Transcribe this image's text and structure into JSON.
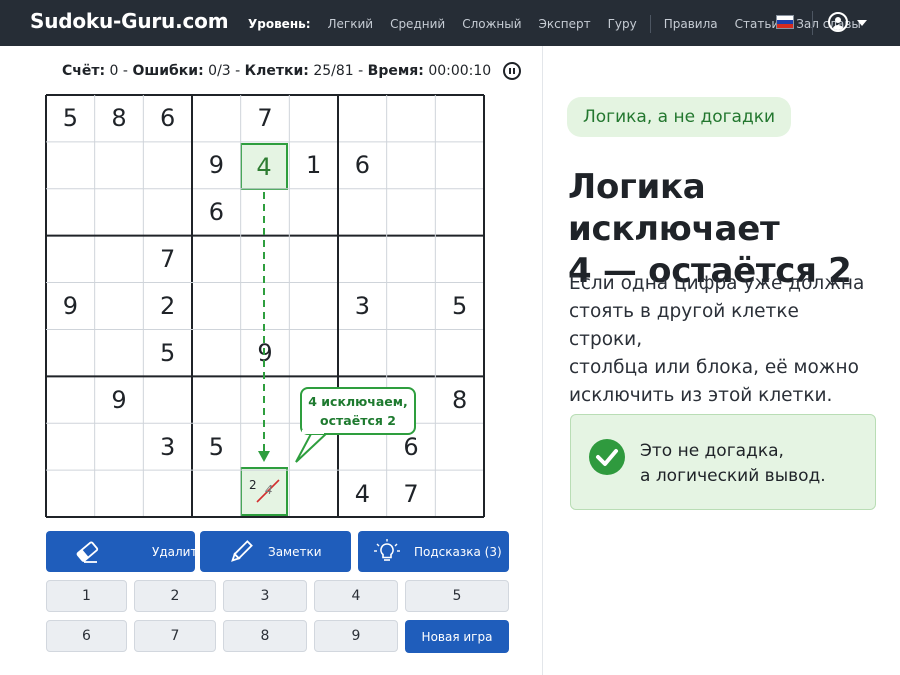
{
  "header": {
    "logo": "Sudoku-Guru.com",
    "level_label": "Уровень:",
    "levels": [
      "Легкий",
      "Средний",
      "Сложный",
      "Эксперт",
      "Гуру"
    ],
    "links": [
      "Правила",
      "Статьи",
      "Зал славы"
    ],
    "flag_colors": [
      "#ffffff",
      "#1c3faa",
      "#d52b1e"
    ]
  },
  "status": {
    "score_label": "Счёт:",
    "score_value": "0",
    "errors_label": "Ошибки:",
    "errors_value": "0/3",
    "cells_label": "Клетки:",
    "cells_value": "25/81",
    "time_label": "Время:",
    "time_value": "00:00:10",
    "sep": "-"
  },
  "board": {
    "grid": [
      [
        5,
        8,
        6,
        0,
        7,
        0,
        0,
        0,
        0
      ],
      [
        0,
        0,
        0,
        9,
        4,
        1,
        6,
        0,
        0
      ],
      [
        0,
        0,
        0,
        6,
        0,
        0,
        0,
        0,
        0
      ],
      [
        0,
        0,
        7,
        0,
        0,
        0,
        0,
        0,
        0
      ],
      [
        9,
        0,
        2,
        0,
        0,
        0,
        3,
        0,
        5
      ],
      [
        0,
        0,
        5,
        0,
        9,
        0,
        0,
        0,
        0
      ],
      [
        0,
        9,
        0,
        0,
        0,
        0,
        0,
        0,
        8
      ],
      [
        0,
        0,
        3,
        5,
        0,
        0,
        0,
        6,
        0
      ],
      [
        0,
        0,
        0,
        0,
        0,
        0,
        4,
        7,
        0
      ]
    ],
    "focus_value": "4",
    "focus_cell": [
      1,
      4
    ],
    "target_cell": [
      8,
      4
    ],
    "note_kept": "2",
    "note_struck": "4",
    "callout_line1": "4 исключаем,",
    "callout_line2": "остаётся 2",
    "highlight_color": "#2e9e3e"
  },
  "actions": {
    "erase": "Удалить",
    "notes": "Заметки",
    "hint": "Подсказка (3)"
  },
  "numpad": {
    "row1": [
      "1",
      "2",
      "3",
      "4",
      "5"
    ],
    "row2": [
      "6",
      "7",
      "8",
      "9"
    ],
    "new_game": "Новая игра"
  },
  "panel": {
    "tag": "Логика, а не догадки",
    "headline_line1": "Логика исключает",
    "headline_line2": "4 — остаётся 2",
    "paragraph": [
      "Если одна цифра уже должна",
      "стоять в другой клетке строки,",
      "столбца или блока, её можно",
      "исключить из этой клетки."
    ],
    "note_line1": "Это не догадка,",
    "note_line2": "а логический вывод."
  },
  "colors": {
    "topbar": "#262d36",
    "primary_button": "#1f5dbb",
    "accent_green": "#2e9e3e",
    "light_green": "#e5f4e3"
  },
  "icons": [
    "eraser-icon",
    "pencil-icon",
    "lightbulb-icon",
    "pause-icon",
    "user-icon",
    "check-icon",
    "flag-icon",
    "chevron-down-icon"
  ]
}
